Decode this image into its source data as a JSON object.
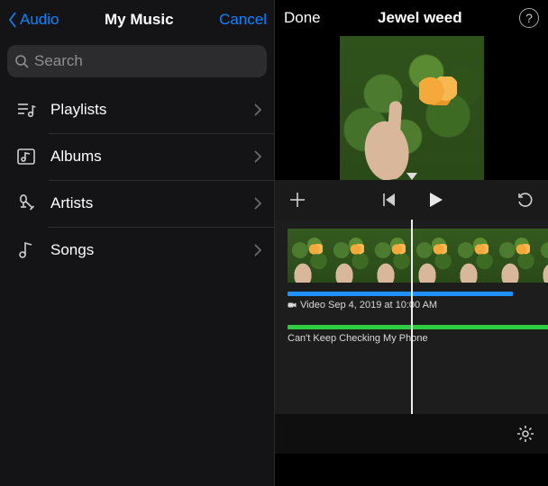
{
  "left": {
    "back_label": "Audio",
    "title": "My Music",
    "cancel_label": "Cancel",
    "search_placeholder": "Search",
    "items": [
      {
        "label": "Playlists",
        "icon": "playlists-icon"
      },
      {
        "label": "Albums",
        "icon": "albums-icon"
      },
      {
        "label": "Artists",
        "icon": "artists-icon"
      },
      {
        "label": "Songs",
        "icon": "songs-icon"
      }
    ]
  },
  "right": {
    "done_label": "Done",
    "title": "Jewel weed",
    "help_glyph": "?",
    "controls": {
      "add": "add-media",
      "skip_back": "skip-to-start",
      "play": "play",
      "undo": "undo"
    },
    "video_track_label": "Video Sep 4, 2019 at 10:00 AM",
    "audio_track_label": "Can't Keep Checking My Phone",
    "colors": {
      "video_track": "#1e90ff",
      "audio_track": "#2ecc40",
      "accent": "#0a84ff"
    }
  }
}
